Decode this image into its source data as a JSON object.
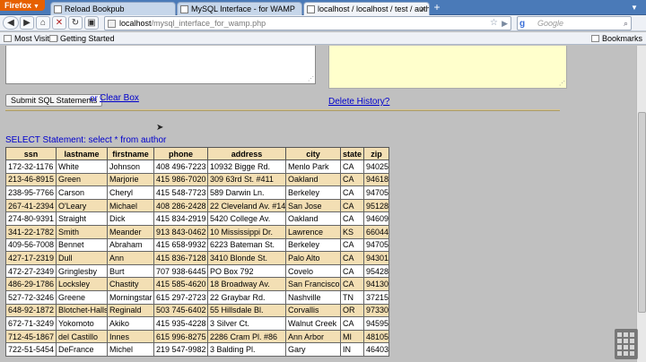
{
  "browser": {
    "app_button": "Firefox",
    "tabs": [
      {
        "label": "Reload Bookpub",
        "active": false
      },
      {
        "label": "MySQL Interface - for WAMP",
        "active": false
      },
      {
        "label": "localhost / localhost / test / author | ...",
        "active": true
      }
    ],
    "url_host": "localhost",
    "url_path": "/mysql_interface_for_wamp.php",
    "search_placeholder": "Google",
    "bookmarks": [
      "Most Visited",
      "Getting Started"
    ],
    "bookmarks_menu": "Bookmarks"
  },
  "page": {
    "submit_label": "Submit SQL Statements",
    "or_text": "or",
    "clear_label": "Clear Box",
    "delete_history_label": "Delete History?",
    "statement": "SELECT Statement: select * from author"
  },
  "table": {
    "columns": [
      "ssn",
      "lastname",
      "firstname",
      "phone",
      "address",
      "city",
      "state",
      "zip"
    ],
    "rows": [
      [
        "172-32-1176",
        "White",
        "Johnson",
        "408 496-7223",
        "10932 Bigge Rd.",
        "Menlo Park",
        "CA",
        "94025"
      ],
      [
        "213-46-8915",
        "Green",
        "Marjorie",
        "415 986-7020",
        "309 63rd St. #411",
        "Oakland",
        "CA",
        "94618"
      ],
      [
        "238-95-7766",
        "Carson",
        "Cheryl",
        "415 548-7723",
        "589 Darwin Ln.",
        "Berkeley",
        "CA",
        "94705"
      ],
      [
        "267-41-2394",
        "O'Leary",
        "Michael",
        "408 286-2428",
        "22 Cleveland Av. #14",
        "San Jose",
        "CA",
        "95128"
      ],
      [
        "274-80-9391",
        "Straight",
        "Dick",
        "415 834-2919",
        "5420 College Av.",
        "Oakland",
        "CA",
        "94609"
      ],
      [
        "341-22-1782",
        "Smith",
        "Meander",
        "913 843-0462",
        "10 Mississippi Dr.",
        "Lawrence",
        "KS",
        "66044"
      ],
      [
        "409-56-7008",
        "Bennet",
        "Abraham",
        "415 658-9932",
        "6223 Bateman St.",
        "Berkeley",
        "CA",
        "94705"
      ],
      [
        "427-17-2319",
        "Dull",
        "Ann",
        "415 836-7128",
        "3410 Blonde St.",
        "Palo Alto",
        "CA",
        "94301"
      ],
      [
        "472-27-2349",
        "Gringlesby",
        "Burt",
        "707 938-6445",
        "PO Box 792",
        "Covelo",
        "CA",
        "95428"
      ],
      [
        "486-29-1786",
        "Locksley",
        "Chastity",
        "415 585-4620",
        "18 Broadway Av.",
        "San Francisco",
        "CA",
        "94130"
      ],
      [
        "527-72-3246",
        "Greene",
        "Morningstar",
        "615 297-2723",
        "22 Graybar Rd.",
        "Nashville",
        "TN",
        "37215"
      ],
      [
        "648-92-1872",
        "Blotchet-Halls",
        "Reginald",
        "503 745-6402",
        "55 Hillsdale Bl.",
        "Corvallis",
        "OR",
        "97330"
      ],
      [
        "672-71-3249",
        "Yokomoto",
        "Akiko",
        "415 935-4228",
        "3 Silver Ct.",
        "Walnut Creek",
        "CA",
        "94595"
      ],
      [
        "712-45-1867",
        "del Castillo",
        "Innes",
        "615 996-8275",
        "2286 Cram Pl. #86",
        "Ann Arbor",
        "MI",
        "48105"
      ],
      [
        "722-51-5454",
        "DeFrance",
        "Michel",
        "219 547-9982",
        "3 Balding Pl.",
        "Gary",
        "IN",
        "46403"
      ]
    ]
  },
  "colors": {
    "header_bg": "#f3dfb4",
    "link": "#0000cc",
    "history_bg": "#ffffcc"
  }
}
